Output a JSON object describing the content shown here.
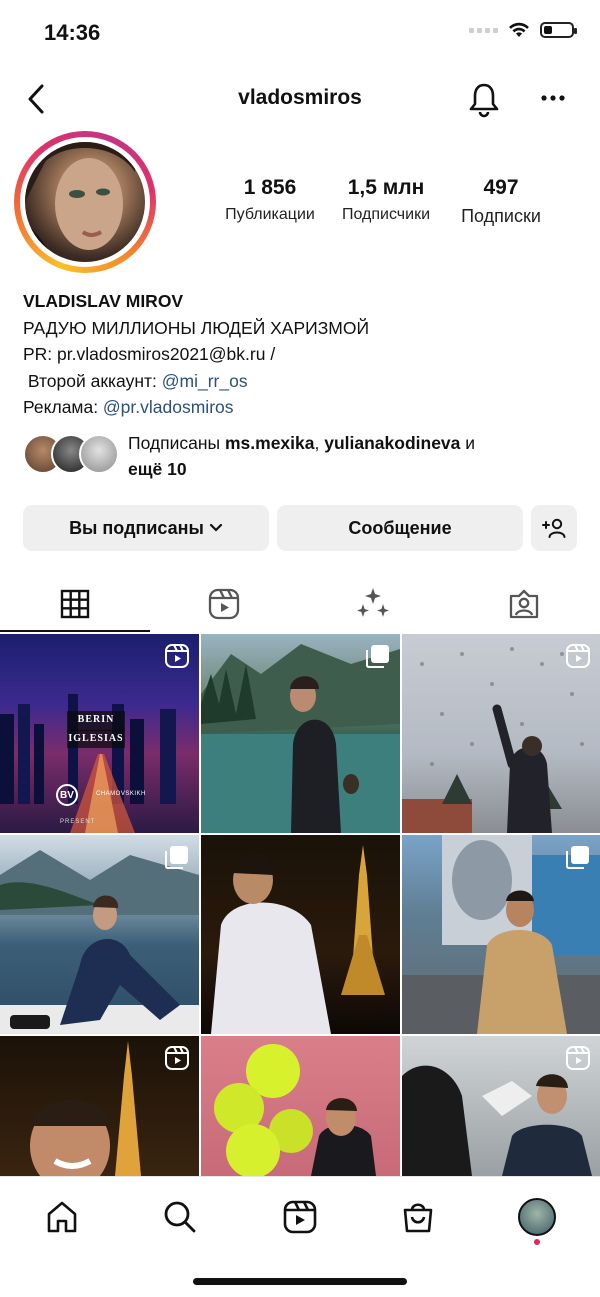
{
  "status_bar": {
    "time": "14:36"
  },
  "header": {
    "username": "vladosmiros"
  },
  "stats": [
    {
      "value": "1 856",
      "label": "Публикации"
    },
    {
      "value": "1,5 млн",
      "label": "Подписчики"
    },
    {
      "value": "497",
      "label": "Подписки"
    }
  ],
  "bio": {
    "name": "VLADISLAV MIROV",
    "line1": "РАДУЮ МИЛЛИОНЫ ЛЮДЕЙ ХАРИЗМОЙ",
    "line2": "PR: pr.vladosmiros2021@bk.ru /",
    "line3_prefix": " Второй аккаунт: ",
    "line3_link": "@mi_rr_os",
    "line4_prefix": "Реклама: ",
    "line4_link": "@pr.vladosmiros"
  },
  "followed_by": {
    "prefix": "Подписаны ",
    "user1": "ms.mexika",
    "separator": ", ",
    "user2": "yulianakodineva",
    "suffix": " и",
    "more": "ещё 10"
  },
  "buttons": {
    "following": "Вы подписаны",
    "message": "Сообщение"
  },
  "posts": {
    "post1_title_line1": "BERIN",
    "post1_title_line2": "IGLESIAS",
    "post1_brand": "CHAMOVSKIKH",
    "post1_present": "PRESENT"
  },
  "colors": {
    "link": "#2d4f7c",
    "button_bg": "#efefef",
    "notification_dot": "#e0245e"
  }
}
